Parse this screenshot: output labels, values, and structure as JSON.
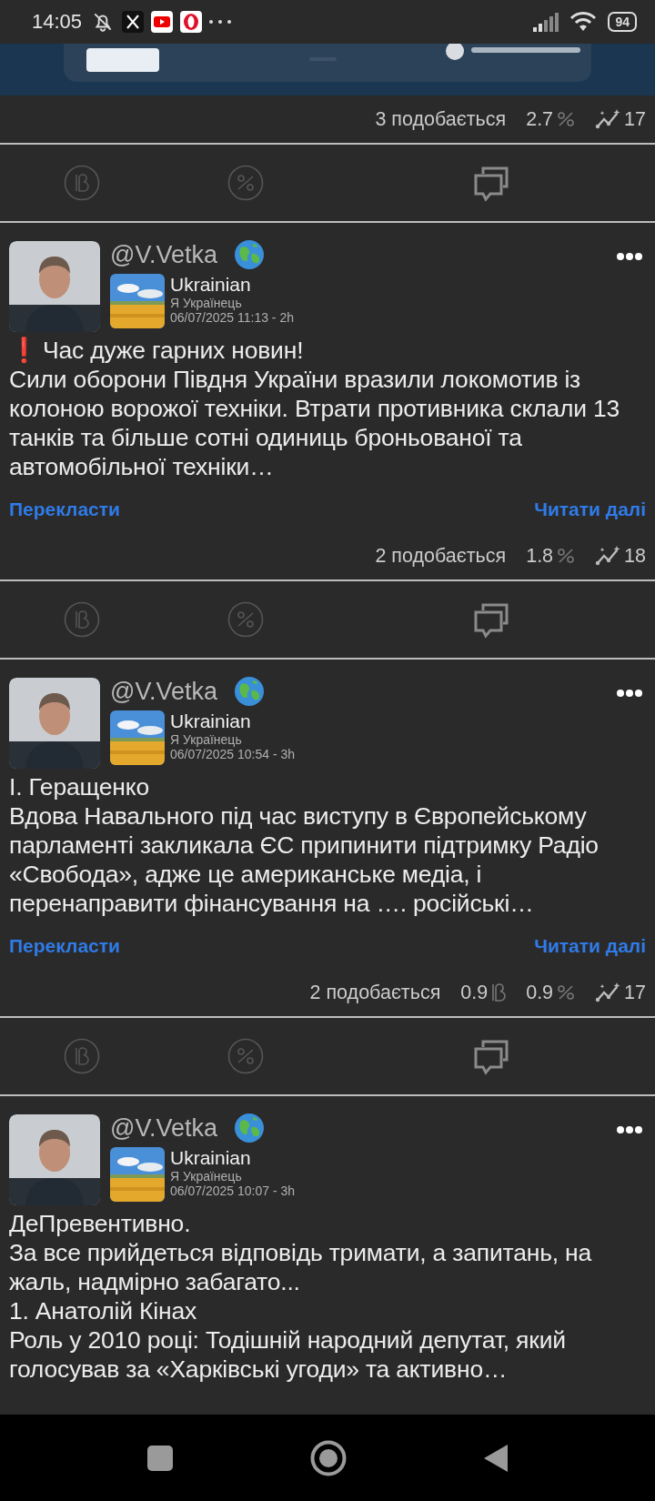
{
  "status_bar": {
    "time": "14:05",
    "battery": "94"
  },
  "top_post": {
    "stats": {
      "likes": "3 подобається",
      "percent": "2.7",
      "views": "17"
    }
  },
  "posts": [
    {
      "author": "@V.Vetka",
      "group": "Ukrainian",
      "group_subtitle": "Я Українець",
      "date": "06/07/2025 11:13 - 2h",
      "lead_icon": "❗",
      "text": "Час дуже гарних новин!\nСили оборони Півдня України вразили локомотив із колоною ворожої техніки. Втрати противника склали 13 танків та більше сотні одиниць броньованої та автомобільної техніки…",
      "translate": "Перекласти",
      "read_more": "Читати далі",
      "stats": {
        "likes": "2 подобається",
        "percent": "1.8",
        "views": "18"
      }
    },
    {
      "author": "@V.Vetka",
      "group": "Ukrainian",
      "group_subtitle": "Я Українець",
      "date": "06/07/2025 10:54 - 3h",
      "text": "І. Геращенко\nВдова Навального під час виступу в Європейському парламенті закликала ЄС припинити підтримку Радіо «Свобода», адже це американське медіа,  і перенаправити фінансування на …. російські…",
      "translate": "Перекласти",
      "read_more": "Читати далі",
      "stats": {
        "likes": "2 подобається",
        "b_value": "0.9",
        "percent": "0.9",
        "views": "17"
      }
    },
    {
      "author": "@V.Vetka",
      "group": "Ukrainian",
      "group_subtitle": "Я Українець",
      "date": "06/07/2025 10:07 - 3h",
      "text": "ДеПревентивно.\nЗа все прийдеться відповідь тримати, а запитань, на жаль, надмірно забагато...\n1. Анатолій Кінах\nРоль у 2010 році: Тодішній народний депутат, який голосував за «Харківські угоди» та активно…"
    }
  ]
}
